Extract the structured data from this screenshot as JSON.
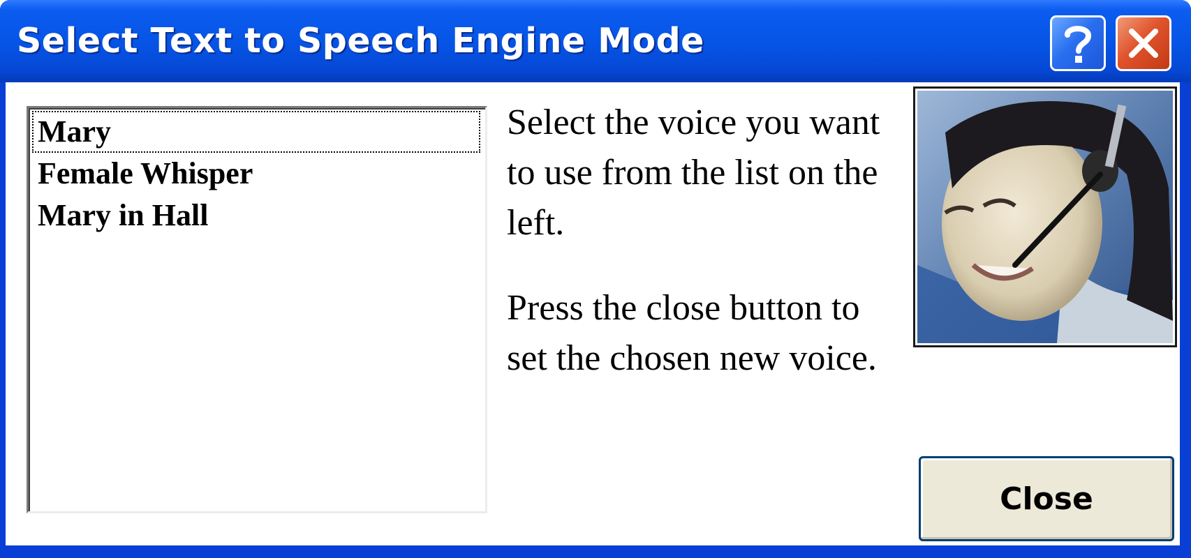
{
  "window": {
    "title": "Select Text to Speech Engine Mode",
    "help_icon": "question-mark-icon",
    "close_icon": "close-x-icon"
  },
  "voices": {
    "items": [
      "Mary",
      "Female Whisper",
      "Mary in Hall"
    ],
    "selected": "Mary"
  },
  "instructions": {
    "paragraph1": "Select the voice you want to use from the list on the left.",
    "paragraph2": "Press the close button to set the chosen new voice."
  },
  "buttons": {
    "close_label": "Close"
  },
  "colors": {
    "titlebar": "#0655e6",
    "window_border": "#0a3fd6",
    "button_face": "#ece9d8",
    "close_x": "#e0532c"
  }
}
